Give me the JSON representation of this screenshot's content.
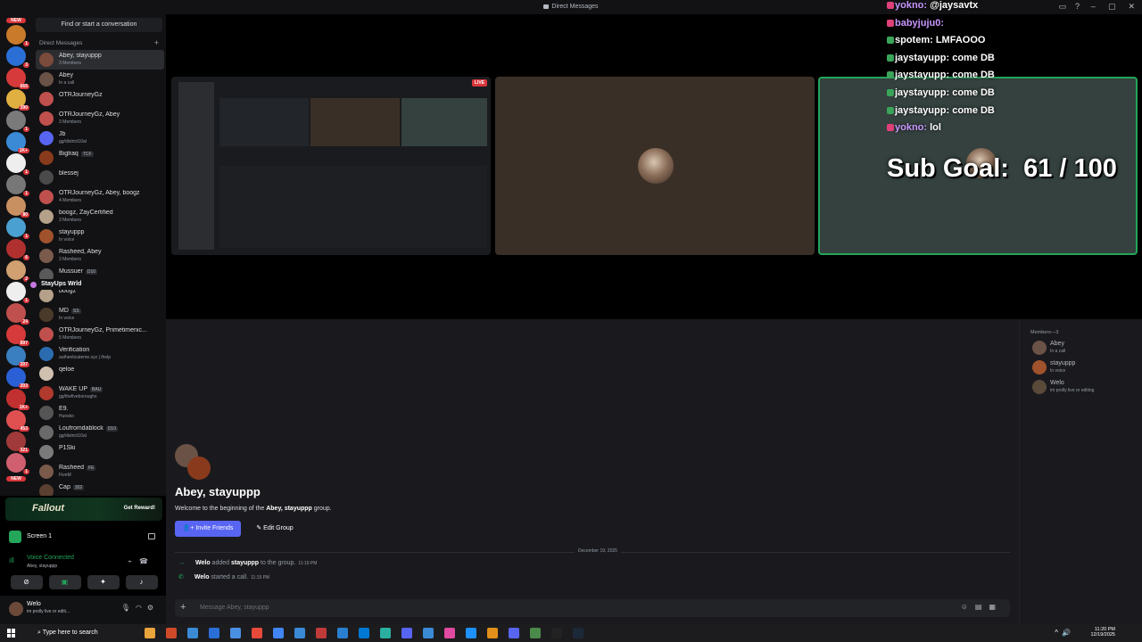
{
  "window": {
    "title": "Direct Messages"
  },
  "server_badges": [
    "NEW",
    "1",
    "3",
    "665",
    "390",
    "1",
    "1K+",
    "1",
    "1",
    "80",
    "1",
    "6",
    "2",
    "1",
    "24",
    "897",
    "207",
    "203",
    "1K+",
    "453",
    "321",
    "1",
    "NEW"
  ],
  "dm_panel": {
    "find_placeholder": "Find or start a conversation",
    "header": "Direct Messages",
    "items": [
      {
        "name": "Abey, stayuppp",
        "sub": "3 Members",
        "color": "#7a4a3a",
        "selected": true
      },
      {
        "name": "Abey",
        "sub": "In a call",
        "color": "#6b5246"
      },
      {
        "name": "OTRJourneyGz",
        "sub": "",
        "color": "#c0504d"
      },
      {
        "name": "OTRJourneyGz, Abey",
        "sub": "3 Members",
        "color": "#c0504d"
      },
      {
        "name": "Jb",
        "sub": "gg/district10al",
        "color": "#5865f2"
      },
      {
        "name": "Biglraq",
        "tag": "TCF",
        "sub": "",
        "color": "#8a3a1c"
      },
      {
        "name": "blessej",
        "sub": "",
        "color": "#4a4a4a"
      },
      {
        "name": "OTRJourneyGz, Abey, boogz",
        "sub": "4 Members",
        "color": "#c0504d"
      },
      {
        "name": "boogz, ZayCertified",
        "sub": "3 Members",
        "color": "#b5a08a"
      },
      {
        "name": "stayuppp",
        "sub": "In voice",
        "color": "#a0522d"
      },
      {
        "name": "Rasheed, Abey",
        "sub": "3 Members",
        "color": "#7a5a4a"
      },
      {
        "name": "Mussuer",
        "tag": "D10",
        "sub": "",
        "color": "#5a5a5a"
      },
      {
        "name": "boogz",
        "sub": "",
        "color": "#b5a08a"
      },
      {
        "name": "MD",
        "tag": "SS",
        "sub": "In voice",
        "color": "#4a3a2a"
      },
      {
        "name": "OTRJourneyGz, Primetimenic...",
        "sub": "5 Members",
        "color": "#c0504d"
      },
      {
        "name": "Verification",
        "sub": "authenticateme.xyz | /help",
        "color": "#2b6cb0"
      },
      {
        "name": "qeloe",
        "tag": "",
        "sub": "",
        "color": "#d0c0b0"
      },
      {
        "name": "WAKE UP",
        "tag": "BAU",
        "sub": "gg/thefiveboroughs",
        "color": "#b03a2e"
      },
      {
        "name": "E9.",
        "sub": "Hunsko",
        "color": "#555555"
      },
      {
        "name": "Loufromdablock",
        "tag": "D10",
        "sub": "gg/district10al",
        "color": "#6a6a6a"
      },
      {
        "name": "P1Ski",
        "sub": "",
        "color": "#7a7a7a"
      },
      {
        "name": "Rasheed",
        "tag": "FE",
        "sub": "FiveM",
        "color": "#7a5a4a"
      },
      {
        "name": "Cap",
        "tag": "302",
        "sub": "",
        "color": "#5a4030"
      }
    ],
    "tooltip": "StayUps Wrld"
  },
  "promo": {
    "brand": "Fallout",
    "cta": "Get Reward!"
  },
  "screen_share": {
    "label": "Screen 1"
  },
  "voice": {
    "status": "Voice Connected",
    "channel": "Abey, stayuppp"
  },
  "user": {
    "name": "Welo",
    "status": "im prolly live or editi..."
  },
  "stage": {
    "live_label": "LIVE"
  },
  "chat_overlay": [
    {
      "nick": "yokno",
      "msg": "@jaysavtx",
      "pink": true
    },
    {
      "nick": "babyjuju0",
      "msg": "",
      "pink": true
    },
    {
      "nick": "spotem",
      "msg": "LMFAOOO",
      "pink": false
    },
    {
      "nick": "jaystayupp",
      "msg": "come DB",
      "pink": false
    },
    {
      "nick": "jaystayupp",
      "msg": "come DB",
      "pink": false
    },
    {
      "nick": "jaystayupp",
      "msg": "come DB",
      "pink": false
    },
    {
      "nick": "jaystayupp",
      "msg": "come DB",
      "pink": false
    },
    {
      "nick": "yokno",
      "msg": "lol",
      "pink": true
    }
  ],
  "sub_goal": {
    "label": "Sub Goal:",
    "current": 61,
    "target": 100,
    "text": "61 / 100"
  },
  "chat": {
    "title": "Abey, stayuppp",
    "welcome_prefix": "Welcome to the beginning of the ",
    "welcome_group": "Abey, stayuppp",
    "welcome_suffix": " group.",
    "invite_label": "Invite Friends",
    "edit_label": "Edit Group",
    "date_divider": "December 19, 2025",
    "system_messages": [
      {
        "actor": "Welo",
        "text": " added ",
        "target": "stayuppp",
        "tail": " to the group.",
        "time": "11:19 PM",
        "icon": "→"
      },
      {
        "actor": "Welo",
        "text": " started a call.",
        "target": "",
        "tail": "",
        "time": "11:19 PM",
        "icon": "✆"
      }
    ],
    "composer_placeholder": "Message Abey, stayuppp"
  },
  "members": {
    "header": "Members—3",
    "list": [
      {
        "name": "Abey",
        "sub": "In a call",
        "color": "#6b5246"
      },
      {
        "name": "stayuppp",
        "sub": "In voice",
        "color": "#a0522d"
      },
      {
        "name": "Welo",
        "sub": "im prolly live or editing",
        "color": "#5a4a3a"
      }
    ]
  },
  "taskbar": {
    "search_placeholder": "Type here to search",
    "time": "11:20 PM",
    "date": "12/19/2025"
  }
}
